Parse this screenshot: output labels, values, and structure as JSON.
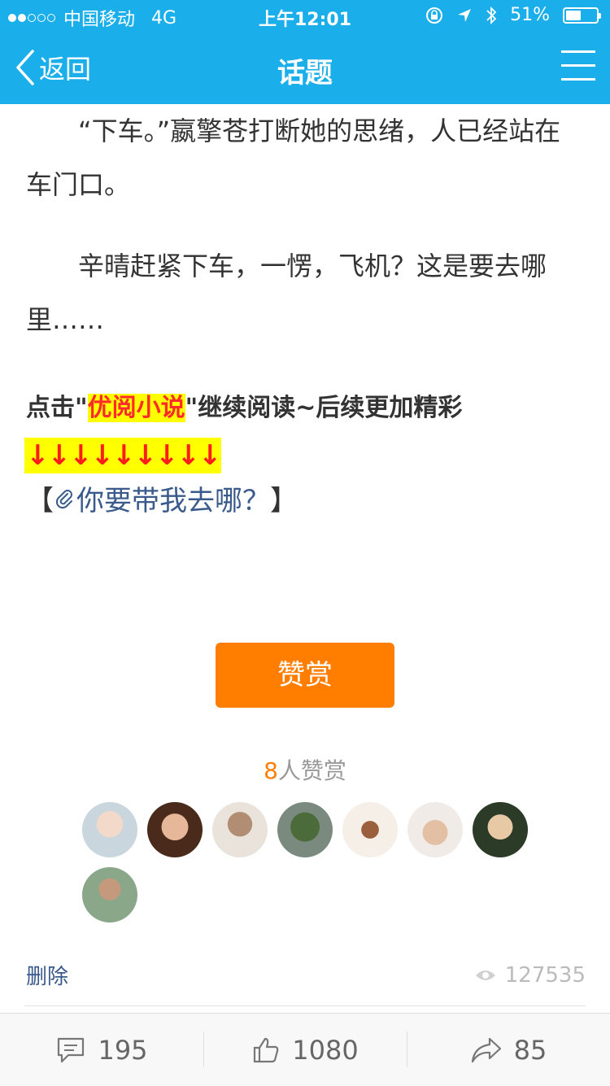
{
  "status_bar": {
    "carrier": "中国移动",
    "network": "4G",
    "time": "上午12:01",
    "battery": "51%",
    "battery_level": 0.51
  },
  "navbar": {
    "back_label": "返回",
    "title": "话题"
  },
  "article": {
    "paragraphs": [
      "“下车。”嬴擎苍打断她的思绪，人已经站在车门口。",
      "辛晴赶紧下车，一愣，飞机？这是要去哪里……"
    ],
    "promo_prefix": "点击\"",
    "promo_highlight": "优阅小说",
    "promo_suffix": "\"继续阅读~后续更加精彩",
    "arrows": "↓↓↓↓↓↓↓↓↓",
    "link_open": "【",
    "link_text": "你要带我去哪？",
    "link_close": "】"
  },
  "reward": {
    "button_label": "赞赏",
    "count": "8",
    "count_suffix": "人赞赏",
    "avatars": [
      "avatar-1",
      "avatar-2",
      "avatar-3",
      "avatar-4",
      "avatar-5",
      "avatar-6",
      "avatar-7",
      "avatar-8"
    ]
  },
  "footer": {
    "delete_label": "删除",
    "views": "127535"
  },
  "bottom_bar": {
    "comments": "195",
    "likes": "1080",
    "shares": "85"
  },
  "colors": {
    "header": "#1aaeea",
    "accent_orange": "#ff7e00",
    "link_blue": "#3a5a8c"
  }
}
